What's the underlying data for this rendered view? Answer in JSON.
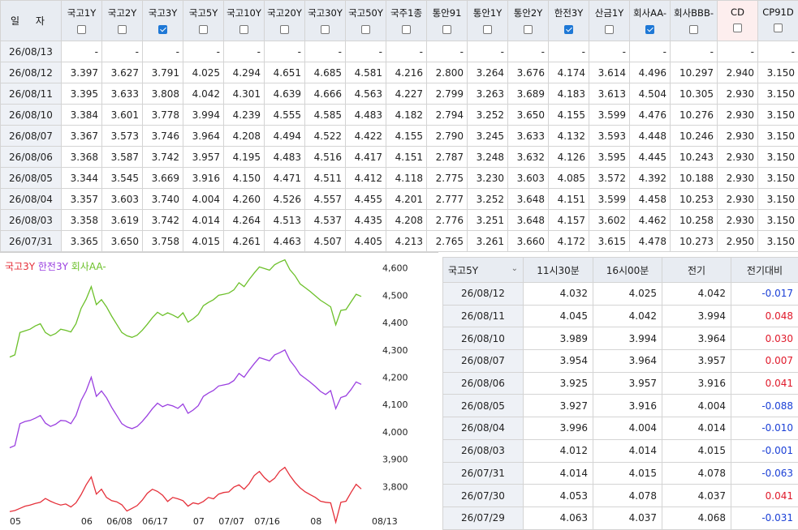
{
  "rate_table": {
    "date_header": "일 자",
    "columns": [
      {
        "label": "국고1Y",
        "checked": false
      },
      {
        "label": "국고2Y",
        "checked": false
      },
      {
        "label": "국고3Y",
        "checked": true
      },
      {
        "label": "국고5Y",
        "checked": false
      },
      {
        "label": "국고10Y",
        "checked": false
      },
      {
        "label": "국고20Y",
        "checked": false
      },
      {
        "label": "국고30Y",
        "checked": false
      },
      {
        "label": "국고50Y",
        "checked": false
      },
      {
        "label": "국주1종",
        "checked": false
      },
      {
        "label": "통안91",
        "checked": false
      },
      {
        "label": "통안1Y",
        "checked": false
      },
      {
        "label": "통안2Y",
        "checked": false
      },
      {
        "label": "한전3Y",
        "checked": true
      },
      {
        "label": "산금1Y",
        "checked": false
      },
      {
        "label": "회사AA-",
        "checked": true
      },
      {
        "label": "회사BBB-",
        "checked": false
      },
      {
        "label": "CD",
        "checked": false
      },
      {
        "label": "CP91D",
        "checked": false
      }
    ],
    "rows": [
      {
        "date": "26/08/13",
        "values": [
          "-",
          "-",
          "-",
          "-",
          "-",
          "-",
          "-",
          "-",
          "-",
          "-",
          "-",
          "-",
          "-",
          "-",
          "-",
          "-",
          "-",
          "-"
        ]
      },
      {
        "date": "26/08/12",
        "values": [
          "3.397",
          "3.627",
          "3.791",
          "4.025",
          "4.294",
          "4.651",
          "4.685",
          "4.581",
          "4.216",
          "2.800",
          "3.264",
          "3.676",
          "4.174",
          "3.614",
          "4.496",
          "10.297",
          "2.940",
          "3.150"
        ]
      },
      {
        "date": "26/08/11",
        "values": [
          "3.395",
          "3.633",
          "3.808",
          "4.042",
          "4.301",
          "4.639",
          "4.666",
          "4.563",
          "4.227",
          "2.799",
          "3.263",
          "3.689",
          "4.183",
          "3.613",
          "4.504",
          "10.305",
          "2.930",
          "3.150"
        ]
      },
      {
        "date": "26/08/10",
        "values": [
          "3.384",
          "3.601",
          "3.778",
          "3.994",
          "4.239",
          "4.555",
          "4.585",
          "4.483",
          "4.182",
          "2.794",
          "3.252",
          "3.650",
          "4.155",
          "3.599",
          "4.476",
          "10.276",
          "2.930",
          "3.150"
        ]
      },
      {
        "date": "26/08/07",
        "values": [
          "3.367",
          "3.573",
          "3.746",
          "3.964",
          "4.208",
          "4.494",
          "4.522",
          "4.422",
          "4.155",
          "2.790",
          "3.245",
          "3.633",
          "4.132",
          "3.593",
          "4.448",
          "10.246",
          "2.930",
          "3.150"
        ]
      },
      {
        "date": "26/08/06",
        "values": [
          "3.368",
          "3.587",
          "3.742",
          "3.957",
          "4.195",
          "4.483",
          "4.516",
          "4.417",
          "4.151",
          "2.787",
          "3.248",
          "3.632",
          "4.126",
          "3.595",
          "4.445",
          "10.243",
          "2.930",
          "3.150"
        ]
      },
      {
        "date": "26/08/05",
        "values": [
          "3.344",
          "3.545",
          "3.669",
          "3.916",
          "4.150",
          "4.471",
          "4.511",
          "4.412",
          "4.118",
          "2.775",
          "3.230",
          "3.603",
          "4.085",
          "3.572",
          "4.392",
          "10.188",
          "2.930",
          "3.150"
        ]
      },
      {
        "date": "26/08/04",
        "values": [
          "3.357",
          "3.603",
          "3.740",
          "4.004",
          "4.260",
          "4.526",
          "4.557",
          "4.455",
          "4.201",
          "2.777",
          "3.252",
          "3.648",
          "4.151",
          "3.599",
          "4.458",
          "10.253",
          "2.930",
          "3.150"
        ]
      },
      {
        "date": "26/08/03",
        "values": [
          "3.358",
          "3.619",
          "3.742",
          "4.014",
          "4.264",
          "4.513",
          "4.537",
          "4.435",
          "4.208",
          "2.776",
          "3.251",
          "3.648",
          "4.157",
          "3.602",
          "4.462",
          "10.258",
          "2.930",
          "3.150"
        ]
      },
      {
        "date": "26/07/31",
        "values": [
          "3.365",
          "3.650",
          "3.758",
          "4.015",
          "4.261",
          "4.463",
          "4.507",
          "4.405",
          "4.213",
          "2.765",
          "3.261",
          "3.660",
          "4.172",
          "3.615",
          "4.478",
          "10.273",
          "2.950",
          "3.150"
        ]
      }
    ]
  },
  "chart_data": {
    "type": "line",
    "legend": [
      {
        "name": "국고3Y",
        "color": "#e5303a"
      },
      {
        "name": "한전3Y",
        "color": "#9a3fe0"
      },
      {
        "name": "회사AA-",
        "color": "#6cc02a"
      }
    ],
    "ylim": [
      3.7,
      4.62
    ],
    "y_ticks": [
      "4,600",
      "4,500",
      "4,400",
      "4,300",
      "4,200",
      "4,100",
      "4,000",
      "3,900",
      "3,800"
    ],
    "x_ticks": [
      {
        "label": "05",
        "at": 0
      },
      {
        "label": "06",
        "at": 14
      },
      {
        "label": "06/08",
        "at": 19
      },
      {
        "label": "06/17",
        "at": 26
      },
      {
        "label": "07",
        "at": 36
      },
      {
        "label": "07/07",
        "at": 41
      },
      {
        "label": "07/16",
        "at": 48
      },
      {
        "label": "08",
        "at": 59
      },
      {
        "label": "08/13",
        "at": 68
      }
    ],
    "series": [
      {
        "name": "국고3Y",
        "color": "#e5303a",
        "values": [
          3.708,
          3.712,
          3.72,
          3.728,
          3.732,
          3.738,
          3.742,
          3.756,
          3.746,
          3.738,
          3.732,
          3.736,
          3.725,
          3.74,
          3.77,
          3.806,
          3.835,
          3.772,
          3.79,
          3.76,
          3.748,
          3.744,
          3.733,
          3.71,
          3.72,
          3.73,
          3.75,
          3.775,
          3.79,
          3.782,
          3.768,
          3.745,
          3.76,
          3.755,
          3.748,
          3.728,
          3.74,
          3.736,
          3.745,
          3.76,
          3.755,
          3.772,
          3.778,
          3.78,
          3.798,
          3.806,
          3.79,
          3.81,
          3.84,
          3.855,
          3.832,
          3.816,
          3.83,
          3.856,
          3.87,
          3.84,
          3.815,
          3.795,
          3.78,
          3.77,
          3.76,
          3.746,
          3.742,
          3.74,
          3.669,
          3.742,
          3.746,
          3.778,
          3.808,
          3.791
        ]
      },
      {
        "name": "한전3Y",
        "color": "#9a3fe0",
        "values": [
          3.942,
          3.95,
          4.03,
          4.038,
          4.042,
          4.05,
          4.06,
          4.032,
          4.02,
          4.028,
          4.042,
          4.04,
          4.03,
          4.06,
          4.115,
          4.15,
          4.2,
          4.13,
          4.15,
          4.125,
          4.09,
          4.06,
          4.03,
          4.018,
          4.012,
          4.02,
          4.038,
          4.06,
          4.085,
          4.105,
          4.092,
          4.1,
          4.095,
          4.086,
          4.102,
          4.068,
          4.08,
          4.096,
          4.13,
          4.142,
          4.152,
          4.168,
          4.172,
          4.176,
          4.188,
          4.214,
          4.2,
          4.226,
          4.25,
          4.272,
          4.266,
          4.26,
          4.282,
          4.29,
          4.3,
          4.262,
          4.238,
          4.21,
          4.196,
          4.182,
          4.166,
          4.148,
          4.137,
          4.151,
          4.085,
          4.126,
          4.132,
          4.155,
          4.183,
          4.174
        ]
      },
      {
        "name": "회사AA-",
        "color": "#6cc02a",
        "values": [
          4.274,
          4.282,
          4.364,
          4.37,
          4.376,
          4.388,
          4.396,
          4.364,
          4.352,
          4.36,
          4.376,
          4.372,
          4.366,
          4.396,
          4.452,
          4.486,
          4.532,
          4.466,
          4.484,
          4.458,
          4.424,
          4.394,
          4.364,
          4.352,
          4.346,
          4.354,
          4.372,
          4.394,
          4.418,
          4.438,
          4.426,
          4.436,
          4.428,
          4.418,
          4.436,
          4.402,
          4.414,
          4.43,
          4.462,
          4.474,
          4.484,
          4.5,
          4.504,
          4.508,
          4.52,
          4.546,
          4.532,
          4.558,
          4.582,
          4.604,
          4.598,
          4.592,
          4.612,
          4.622,
          4.63,
          4.594,
          4.572,
          4.542,
          4.528,
          4.514,
          4.498,
          4.482,
          4.47,
          4.458,
          4.392,
          4.445,
          4.448,
          4.476,
          4.504,
          4.496
        ]
      }
    ]
  },
  "detail_table": {
    "select_label": "국고5Y",
    "headers": [
      "11시30분",
      "16시00분",
      "전기",
      "전기대비"
    ],
    "rows": [
      {
        "date": "26/08/12",
        "v1": "4.032",
        "v2": "4.025",
        "prev": "4.042",
        "diff": "-0.017",
        "sign": "neg"
      },
      {
        "date": "26/08/11",
        "v1": "4.045",
        "v2": "4.042",
        "prev": "3.994",
        "diff": "0.048",
        "sign": "pos"
      },
      {
        "date": "26/08/10",
        "v1": "3.989",
        "v2": "3.994",
        "prev": "3.964",
        "diff": "0.030",
        "sign": "pos"
      },
      {
        "date": "26/08/07",
        "v1": "3.954",
        "v2": "3.964",
        "prev": "3.957",
        "diff": "0.007",
        "sign": "pos"
      },
      {
        "date": "26/08/06",
        "v1": "3.925",
        "v2": "3.957",
        "prev": "3.916",
        "diff": "0.041",
        "sign": "pos"
      },
      {
        "date": "26/08/05",
        "v1": "3.927",
        "v2": "3.916",
        "prev": "4.004",
        "diff": "-0.088",
        "sign": "neg"
      },
      {
        "date": "26/08/04",
        "v1": "3.996",
        "v2": "4.004",
        "prev": "4.014",
        "diff": "-0.010",
        "sign": "neg"
      },
      {
        "date": "26/08/03",
        "v1": "4.012",
        "v2": "4.014",
        "prev": "4.015",
        "diff": "-0.001",
        "sign": "neg"
      },
      {
        "date": "26/07/31",
        "v1": "4.014",
        "v2": "4.015",
        "prev": "4.078",
        "diff": "-0.063",
        "sign": "neg"
      },
      {
        "date": "26/07/30",
        "v1": "4.053",
        "v2": "4.078",
        "prev": "4.037",
        "diff": "0.041",
        "sign": "pos"
      },
      {
        "date": "26/07/29",
        "v1": "4.063",
        "v2": "4.037",
        "prev": "4.068",
        "diff": "-0.031",
        "sign": "neg"
      }
    ]
  }
}
